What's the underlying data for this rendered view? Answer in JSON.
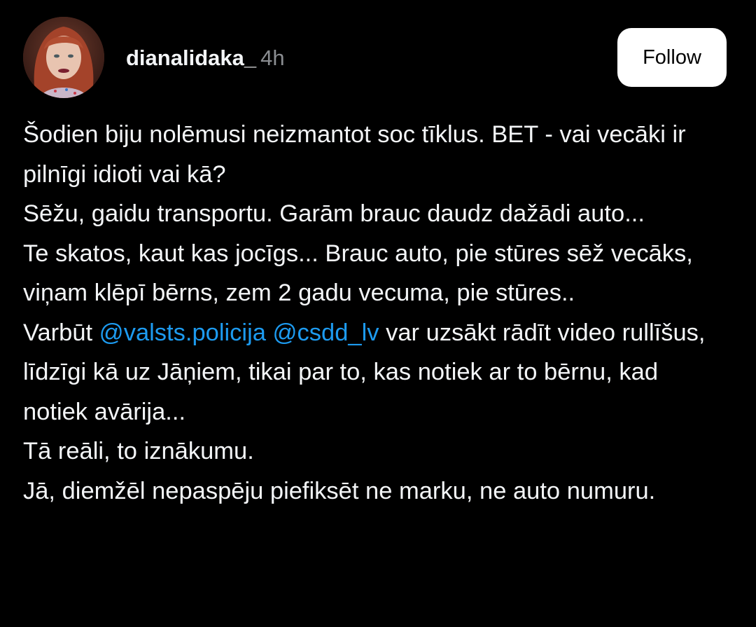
{
  "post": {
    "author": {
      "username": "dianalidaka_",
      "time_ago": "4h"
    },
    "follow_label": "Follow",
    "lines": [
      "Šodien biju nolēmusi neizmantot soc tīklus. BET - vai vecāki ir pilnīgi idioti vai kā?",
      "Sēžu, gaidu transportu. Garām brauc daudz dažādi auto...",
      "Te skatos, kaut kas jocīgs... Brauc auto, pie stūres sēž vecāks, viņam klēpī bērns, zem 2 gadu vecuma, pie stūres.."
    ],
    "mention_line": {
      "prefix": "Varbūt ",
      "mention_1": "@valsts.policija",
      "separator": " ",
      "mention_2": "@csdd_lv",
      "suffix": " var uzsākt rādīt video rullīšus, līdzīgi kā uz Jāņiem, tikai par to, kas notiek ar to bērnu, kad notiek avārija..."
    },
    "closing_lines": [
      "Tā reāli, to iznākumu.",
      "Jā, diemžēl nepaspēju piefiksēt ne marku, ne auto numuru."
    ]
  },
  "colors": {
    "background": "#000000",
    "text": "#f3f5f7",
    "muted": "#8a8d91",
    "mention": "#1d9bf0",
    "button_bg": "#ffffff"
  }
}
